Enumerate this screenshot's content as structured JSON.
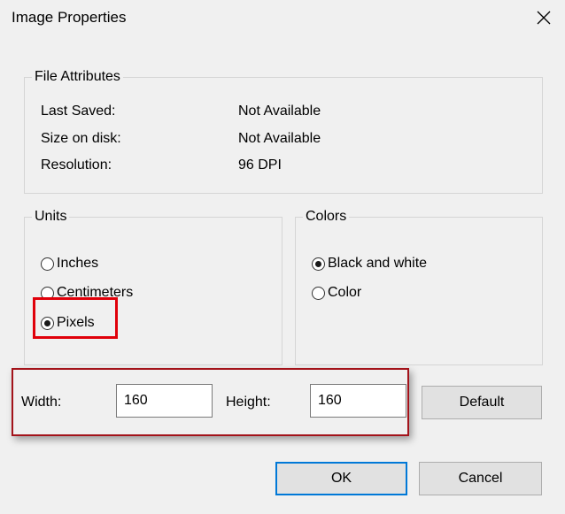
{
  "dialog": {
    "title": "Image Properties",
    "close_icon": "close-icon"
  },
  "file_attributes": {
    "legend": "File Attributes",
    "rows": [
      {
        "label": "Last Saved:",
        "value": "Not Available"
      },
      {
        "label": "Size on disk:",
        "value": "Not Available"
      },
      {
        "label": "Resolution:",
        "value": "96 DPI"
      }
    ]
  },
  "units": {
    "legend": "Units",
    "options": [
      {
        "label": "Inches",
        "checked": false
      },
      {
        "label": "Centimeters",
        "checked": false
      },
      {
        "label": "Pixels",
        "checked": true
      }
    ]
  },
  "colors": {
    "legend": "Colors",
    "options": [
      {
        "label": "Black and white",
        "checked": true
      },
      {
        "label": "Color",
        "checked": false
      }
    ]
  },
  "size": {
    "width_label": "Width:",
    "width_value": "160",
    "height_label": "Height:",
    "height_value": "160"
  },
  "buttons": {
    "default_label": "Default",
    "ok_label": "OK",
    "cancel_label": "Cancel"
  },
  "theme": {
    "accent": "#0078d7",
    "highlight_red": "#e0000a"
  }
}
